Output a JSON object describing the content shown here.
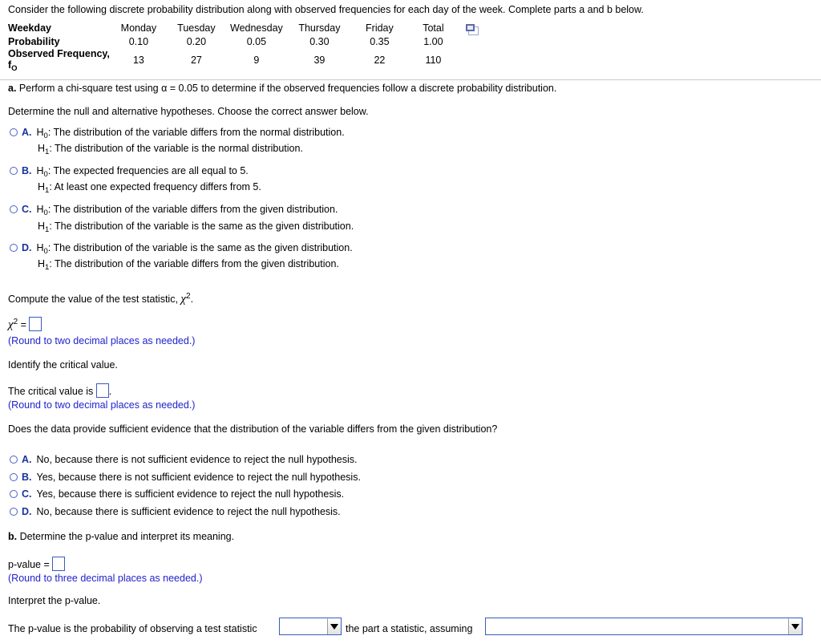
{
  "intro": "Consider the following discrete probability distribution along with observed frequencies for each day of the week. Complete parts a and b below.",
  "table": {
    "row_labels": {
      "weekday": "Weekday",
      "probability": "Probability",
      "observed_line1": "Observed Frequency,",
      "observed_line2_base": "f",
      "observed_line2_sub": "O"
    },
    "columns": [
      "Monday",
      "Tuesday",
      "Wednesday",
      "Thursday",
      "Friday",
      "Total"
    ],
    "probability": [
      "0.10",
      "0.20",
      "0.05",
      "0.30",
      "0.35",
      "1.00"
    ],
    "observed_frequency": [
      "13",
      "27",
      "9",
      "39",
      "22",
      "110"
    ]
  },
  "part_a": {
    "prompt_label": "a.",
    "prompt_text": " Perform a chi-square test using α = 0.05 to determine if the observed frequencies follow a discrete probability distribution.",
    "hypotheses_instruction": "Determine the null and alternative hypotheses. Choose the correct answer below.",
    "choices": [
      {
        "letter": "A.",
        "h0_base": "H",
        "h0_sub": "0",
        "h0_text": ": The distribution of the variable differs from the normal distribution.",
        "h1_base": "H",
        "h1_sub": "1",
        "h1_text": ": The distribution of the variable is the normal distribution."
      },
      {
        "letter": "B.",
        "h0_base": "H",
        "h0_sub": "0",
        "h0_text": ": The expected frequencies are all equal to 5.",
        "h1_base": "H",
        "h1_sub": "1",
        "h1_text": ": At least one expected frequency differs from 5."
      },
      {
        "letter": "C.",
        "h0_base": "H",
        "h0_sub": "0",
        "h0_text": ": The distribution of the variable differs from the given distribution.",
        "h1_base": "H",
        "h1_sub": "1",
        "h1_text": ": The distribution of the variable is the same as the given distribution."
      },
      {
        "letter": "D.",
        "h0_base": "H",
        "h0_sub": "0",
        "h0_text": ": The distribution of the variable is the same as the given distribution.",
        "h1_base": "H",
        "h1_sub": "1",
        "h1_text": ": The distribution of the variable differs from the given distribution."
      }
    ],
    "test_statistic": {
      "instruction_pre": "Compute the value of the test statistic, ",
      "symbol": "χ",
      "symbol_sup": "2",
      "instruction_post": ".",
      "equation_symbol": "χ",
      "equation_sup": "2",
      "equation_equals": " = ",
      "input_value": "",
      "rounding_note": "(Round to two decimal places as needed.)"
    },
    "critical_value": {
      "instruction": "Identify the critical value.",
      "sentence_pre": "The critical value is ",
      "input_value": "",
      "sentence_post": ".",
      "rounding_note": "(Round to two decimal places as needed.)"
    },
    "conclusion_question": "Does the data provide sufficient evidence that the distribution of the variable differs from the given distribution?",
    "conclusion_choices": [
      {
        "letter": "A.",
        "text": "No, because there is not sufficient evidence to reject the null hypothesis."
      },
      {
        "letter": "B.",
        "text": "Yes, because there is not sufficient evidence to reject the null hypothesis."
      },
      {
        "letter": "C.",
        "text": "Yes, because there is sufficient evidence to reject the null hypothesis."
      },
      {
        "letter": "D.",
        "text": "No, because there is sufficient evidence to reject the null hypothesis."
      }
    ]
  },
  "part_b": {
    "prompt_label": "b.",
    "prompt_text": " Determine the p-value and interpret its meaning.",
    "pvalue_label": "p-value = ",
    "pvalue_input": "",
    "rounding_note": "(Round to three decimal places as needed.)",
    "interpret_instruction": "Interpret the p-value.",
    "sentence_part1": "The p-value is the probability of observing a test statistic",
    "dropdown1_value": "",
    "sentence_part2": "the part a statistic, assuming",
    "dropdown2_value": ""
  },
  "colors": {
    "link_blue": "#2222cc",
    "option_blue": "#17339e",
    "input_border": "#3b5bbf",
    "divider": "#c9c9c9"
  }
}
